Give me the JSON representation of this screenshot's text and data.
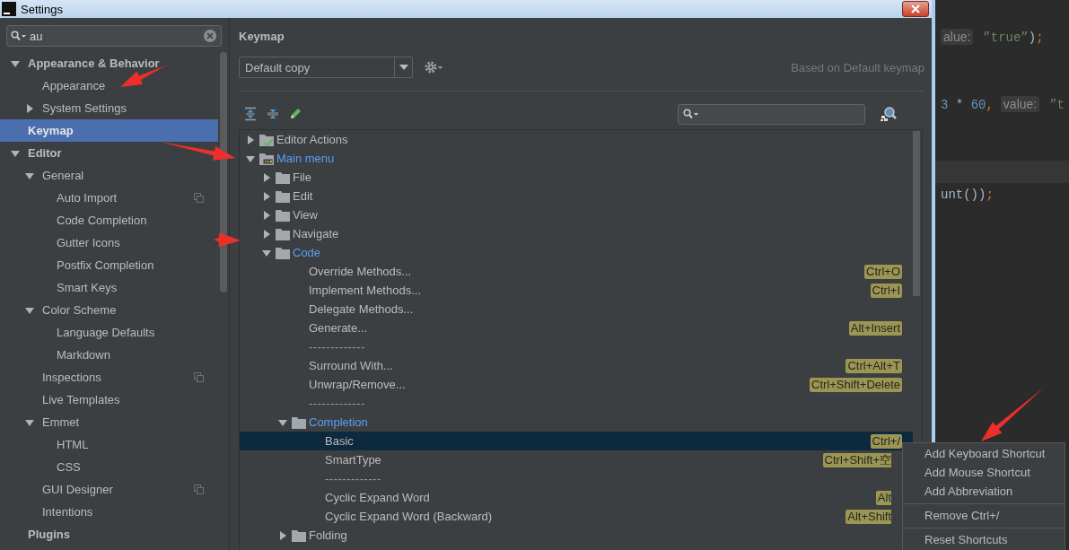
{
  "window": {
    "title": "Settings"
  },
  "sidebar": {
    "search": {
      "value": "au"
    },
    "items": [
      {
        "label": "Appearance & Behavior",
        "expanded": true,
        "selected": false,
        "children": [
          {
            "label": "Appearance",
            "selected": false
          },
          {
            "label": "System Settings",
            "expanded": false,
            "selected": false
          }
        ]
      },
      {
        "label": "Keymap",
        "selected": true
      },
      {
        "label": "Editor",
        "expanded": true,
        "selected": false,
        "children": [
          {
            "label": "General",
            "expanded": true,
            "selected": false,
            "children": [
              {
                "label": "Auto Import",
                "selected": false,
                "project_level": true
              },
              {
                "label": "Code Completion",
                "selected": false
              },
              {
                "label": "Gutter Icons",
                "selected": false
              },
              {
                "label": "Postfix Completion",
                "selected": false
              },
              {
                "label": "Smart Keys",
                "selected": false
              }
            ]
          },
          {
            "label": "Color Scheme",
            "expanded": true,
            "selected": false,
            "children": [
              {
                "label": "Language Defaults",
                "selected": false
              },
              {
                "label": "Markdown",
                "selected": false
              }
            ]
          },
          {
            "label": "Inspections",
            "selected": false,
            "project_level": true
          },
          {
            "label": "Live Templates",
            "selected": false
          },
          {
            "label": "Emmet",
            "expanded": true,
            "selected": false,
            "children": [
              {
                "label": "HTML",
                "selected": false
              },
              {
                "label": "CSS",
                "selected": false
              }
            ]
          },
          {
            "label": "GUI Designer",
            "selected": false,
            "project_level": true
          },
          {
            "label": "Intentions",
            "selected": false
          }
        ]
      },
      {
        "label": "Plugins",
        "selected": false
      }
    ]
  },
  "keymap": {
    "title": "Keymap",
    "keymap_select": "Default copy",
    "based_on": "Based on Default keymap",
    "tree": [
      {
        "label": "Editor Actions",
        "kind": "actions-group",
        "expanded": false,
        "modified": false,
        "selected": false
      },
      {
        "label": "Main menu",
        "kind": "menu-group",
        "expanded": true,
        "modified": true,
        "selected": false,
        "children": [
          {
            "label": "File",
            "kind": "folder",
            "expanded": false,
            "modified": false,
            "selected": false
          },
          {
            "label": "Edit",
            "kind": "folder",
            "expanded": false,
            "modified": false,
            "selected": false
          },
          {
            "label": "View",
            "kind": "folder",
            "expanded": false,
            "modified": false,
            "selected": false
          },
          {
            "label": "Navigate",
            "kind": "folder",
            "expanded": false,
            "modified": false,
            "selected": false
          },
          {
            "label": "Code",
            "kind": "folder",
            "expanded": true,
            "modified": true,
            "selected": false,
            "children": [
              {
                "label": "Override Methods...",
                "kind": "action",
                "shortcut": "Ctrl+O",
                "selected": false
              },
              {
                "label": "Implement Methods...",
                "kind": "action",
                "shortcut": "Ctrl+I",
                "selected": false
              },
              {
                "label": "Delegate Methods...",
                "kind": "action",
                "selected": false
              },
              {
                "label": "Generate...",
                "kind": "action",
                "shortcut": "Alt+Insert",
                "selected": false
              },
              {
                "label": "-------------",
                "kind": "separator",
                "selected": false
              },
              {
                "label": "Surround With...",
                "kind": "action",
                "shortcut": "Ctrl+Alt+T",
                "selected": false
              },
              {
                "label": "Unwrap/Remove...",
                "kind": "action",
                "shortcut": "Ctrl+Shift+Delete",
                "selected": false
              },
              {
                "label": "-------------",
                "kind": "separator",
                "selected": false
              },
              {
                "label": "Completion",
                "kind": "folder",
                "expanded": true,
                "modified": true,
                "selected": false,
                "children": [
                  {
                    "label": "Basic",
                    "kind": "action",
                    "shortcut": "Ctrl+/",
                    "selected": true
                  },
                  {
                    "label": "SmartType",
                    "kind": "action",
                    "shortcut": "Ctrl+Shift+空",
                    "shortcut_covered": true,
                    "selected": false
                  },
                  {
                    "label": "-------------",
                    "kind": "separator",
                    "selected": false
                  },
                  {
                    "label": "Cyclic Expand Word",
                    "kind": "action",
                    "shortcut": "Alt",
                    "shortcut_covered": true,
                    "selected": false
                  },
                  {
                    "label": "Cyclic Expand Word (Backward)",
                    "kind": "action",
                    "shortcut": "Alt+Shift",
                    "shortcut_covered": true,
                    "selected": false
                  }
                ]
              },
              {
                "label": "Folding",
                "kind": "folder",
                "expanded": false,
                "modified": false,
                "selected": false
              }
            ]
          }
        ]
      }
    ]
  },
  "context_menu": [
    {
      "kind": "item",
      "label": "Add Keyboard Shortcut"
    },
    {
      "kind": "item",
      "label": "Add Mouse Shortcut"
    },
    {
      "kind": "item",
      "label": "Add Abbreviation"
    },
    {
      "kind": "separator"
    },
    {
      "kind": "item",
      "label": "Remove Ctrl+/"
    },
    {
      "kind": "separator"
    },
    {
      "kind": "item",
      "label": "Reset Shortcuts"
    }
  ],
  "editor": {
    "lines": [
      {
        "kind": "code",
        "segments": [
          {
            "kind": "hint",
            "text": "alue:"
          },
          {
            "kind": "string",
            "text": "”true”"
          },
          {
            "kind": "plain",
            "text": ")"
          },
          {
            "kind": "semi",
            "text": ";"
          }
        ]
      },
      {
        "kind": "blank"
      },
      {
        "kind": "blank"
      },
      {
        "kind": "code",
        "segments": [
          {
            "kind": "number",
            "text": "3"
          },
          {
            "kind": "plain",
            "text": " * "
          },
          {
            "kind": "number",
            "text": "60"
          },
          {
            "kind": "semi",
            "text": ","
          },
          {
            "kind": "hint",
            "text": "value:"
          },
          {
            "kind": "string",
            "text": "”t"
          }
        ]
      },
      {
        "kind": "blank"
      },
      {
        "kind": "blank"
      },
      {
        "kind": "current-line"
      },
      {
        "kind": "code",
        "segments": [
          {
            "kind": "plain",
            "text": "unt())"
          },
          {
            "kind": "semi",
            "text": ";"
          }
        ]
      }
    ]
  }
}
